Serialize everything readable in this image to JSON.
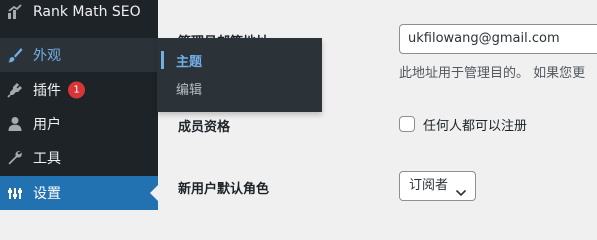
{
  "sidebar": {
    "items": [
      {
        "label": "Rank Math SEO",
        "icon": "rank-math-icon"
      },
      {
        "label": "外观",
        "icon": "paintbrush-icon",
        "state": "hover"
      },
      {
        "label": "插件",
        "icon": "plugin-icon",
        "badge": "1"
      },
      {
        "label": "用户",
        "icon": "user-icon"
      },
      {
        "label": "工具",
        "icon": "wrench-icon"
      },
      {
        "label": "设置",
        "icon": "settings-icon",
        "state": "current"
      }
    ]
  },
  "flyout": {
    "items": [
      {
        "label": "主题",
        "active": true
      },
      {
        "label": "编辑",
        "active": false
      }
    ]
  },
  "form": {
    "admin_email_label": "管理员邮箱地址",
    "admin_email_value": "ukfilowang@gmail.com",
    "admin_email_desc": "此地址用于管理目的。 如果您更",
    "membership_label": "成员资格",
    "membership_checkbox_label": "任何人都可以注册",
    "default_role_label": "新用户默认角色",
    "default_role_value": "订阅者"
  },
  "colors": {
    "sidebar_bg": "#1d2327",
    "current_bg": "#2271b1",
    "hover_text": "#72aee6",
    "badge_bg": "#d63638"
  }
}
